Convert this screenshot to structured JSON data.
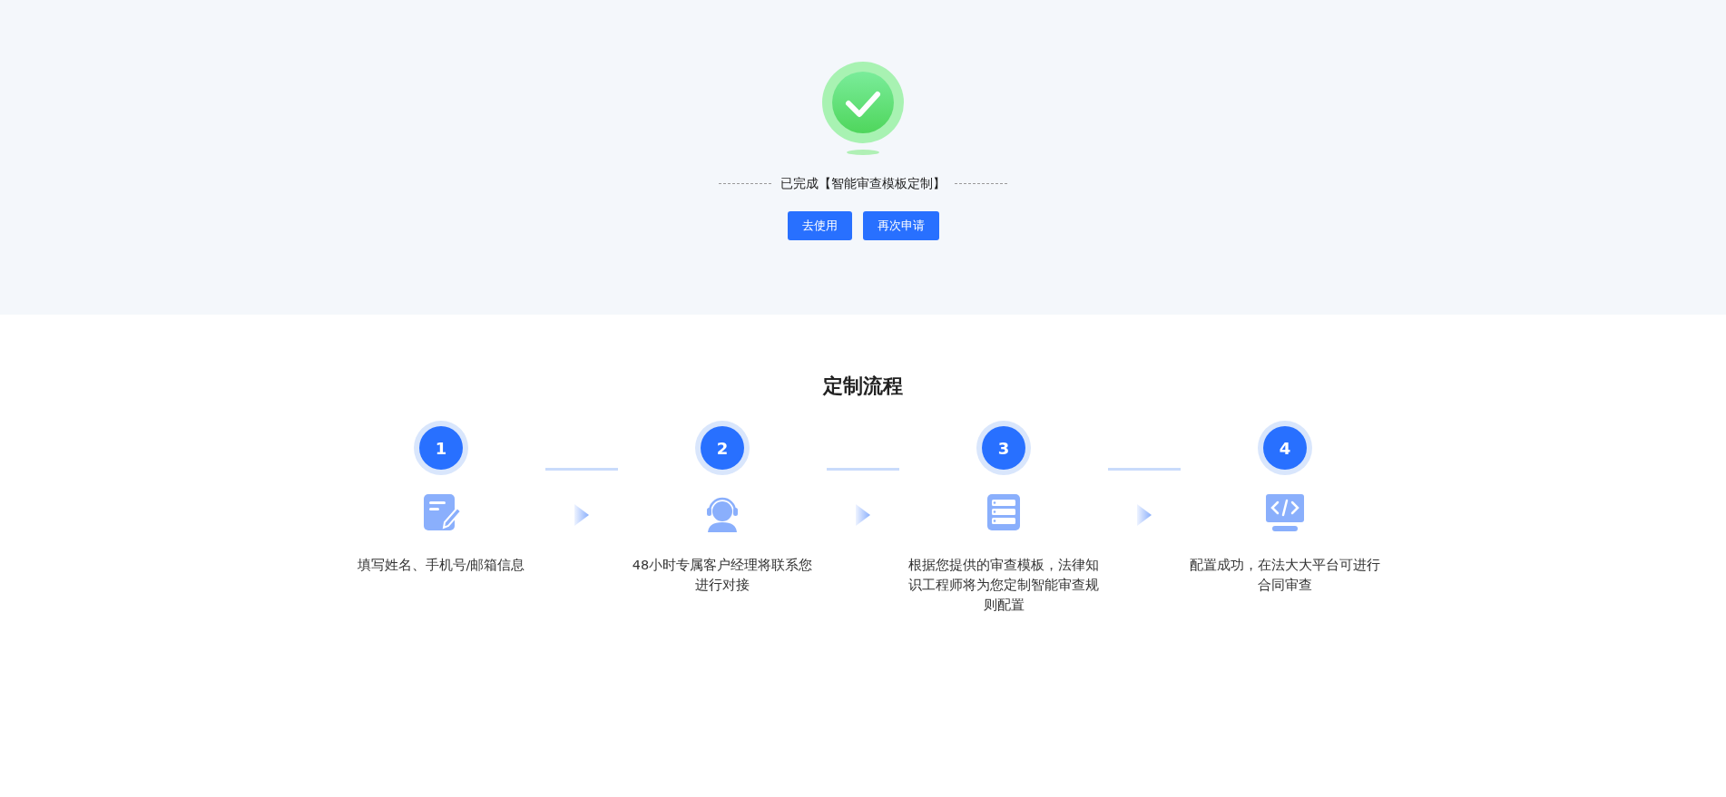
{
  "result": {
    "message": "已完成【智能审查模板定制】",
    "buttons": [
      "去使用",
      "再次申请"
    ]
  },
  "process": {
    "title": "定制流程",
    "steps": [
      {
        "number": "1",
        "kind": "form",
        "text": "填写姓名、手机号/邮箱信息"
      },
      {
        "number": "2",
        "kind": "agent",
        "text": "48小时专属客户经理将联系您进行对接"
      },
      {
        "number": "3",
        "kind": "list",
        "text": "根据您提供的审查模板，法律知识工程师将为您定制智能审查规则配置"
      },
      {
        "number": "4",
        "kind": "code",
        "text": "配置成功，在法大大平台可进行合同审查"
      }
    ]
  }
}
